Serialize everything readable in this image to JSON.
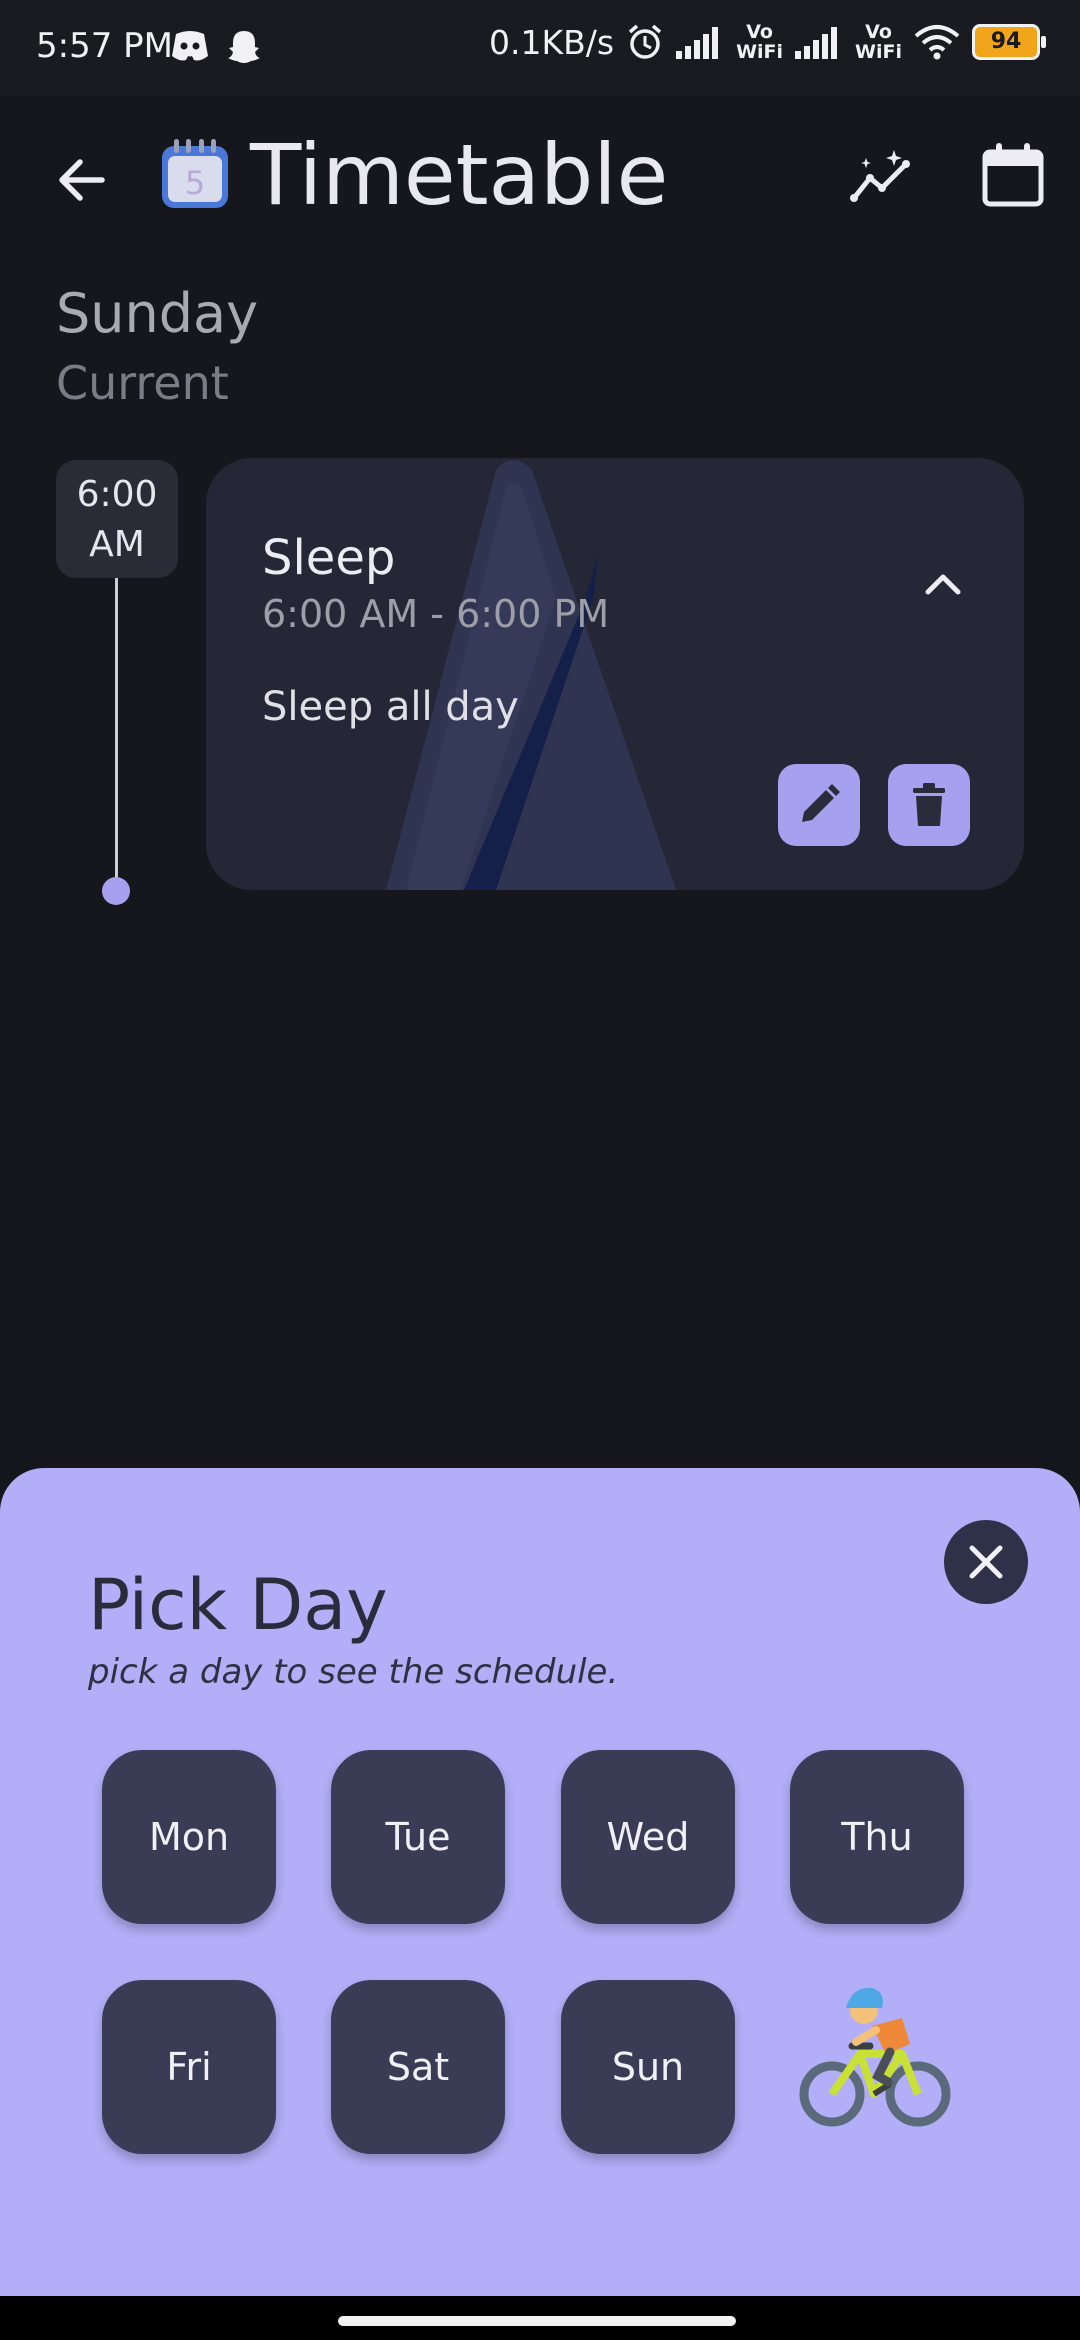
{
  "status_bar": {
    "time": "5:57 PM",
    "net_speed": "0.1KB/s",
    "battery": "94",
    "vowifi_1": "Vo\nWiFi",
    "vowifi_2": "Vo\nWiFi",
    "icons": [
      "discord-icon",
      "snapchat-icon",
      "alarm-icon",
      "signal-icon",
      "signal-icon",
      "wifi-icon",
      "battery-icon"
    ]
  },
  "app_bar": {
    "title": "Timetable",
    "logo_digit": "5",
    "icons": [
      "back-arrow-icon",
      "calendar-logo-icon",
      "insights-icon",
      "calendar-icon"
    ]
  },
  "day": {
    "name": "Sunday",
    "status": "Current"
  },
  "timeline": {
    "start_time_line1": "6:00",
    "start_time_line2": "AM"
  },
  "event": {
    "title": "Sleep",
    "time_range": "6:00 AM - 6:00 PM",
    "note": "Sleep all day",
    "icons": [
      "chevron-up-icon",
      "pencil-icon",
      "trash-icon"
    ]
  },
  "sheet": {
    "title": "Pick Day",
    "subtitle": "pick a day to see the schedule.",
    "days": [
      "Mon",
      "Tue",
      "Wed",
      "Thu",
      "Fri",
      "Sat",
      "Sun"
    ],
    "decoration": "cyclist-emoji"
  },
  "colors": {
    "background": "#16171c",
    "card": "#252736",
    "accent": "#a6a1ee",
    "sheet": "#b2aef7",
    "day_button": "#3a3c56"
  }
}
